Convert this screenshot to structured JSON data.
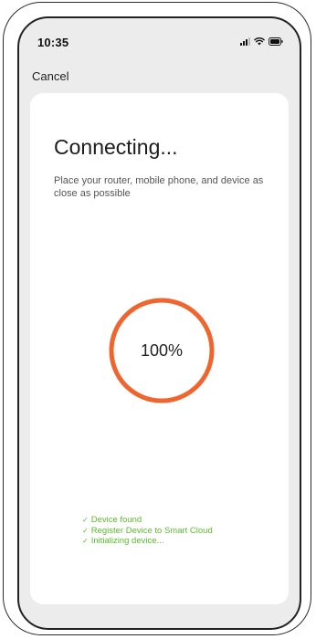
{
  "status_bar": {
    "time": "10:35",
    "signal_icon": "cellular-signal-icon",
    "wifi_icon": "wifi-icon",
    "battery_icon": "battery-icon"
  },
  "nav": {
    "cancel_label": "Cancel"
  },
  "main": {
    "title": "Connecting...",
    "subtitle": "Place your router, mobile phone, and device as close as possible",
    "progress_percent": 100,
    "progress_label": "100%",
    "progress_color": "#f0642e",
    "steps": [
      {
        "label": "Device found",
        "status": "done"
      },
      {
        "label": "Register Device to Smart Cloud",
        "status": "done"
      },
      {
        "label": "Initializing device...",
        "status": "done"
      }
    ],
    "step_color": "#5aba2c",
    "check_icon": "check-icon"
  }
}
